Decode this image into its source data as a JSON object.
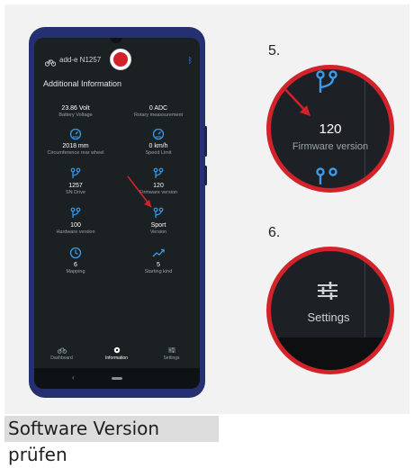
{
  "phone": {
    "device_name": "add-e N1257",
    "section_title": "Additional Information",
    "items": [
      {
        "value": "23.86 Volt",
        "label": "Battery Voltage",
        "icon": "none"
      },
      {
        "value": "0 ADC",
        "label": "Rotary meassurement",
        "icon": "none"
      },
      {
        "value": "2018 mm",
        "label": "Circumference rear wheel",
        "icon": "speedometer-icon"
      },
      {
        "value": "0 km/h",
        "label": "Speed Limit",
        "icon": "speedometer-icon"
      },
      {
        "value": "1257",
        "label": "SN Drive",
        "icon": "branch-icon"
      },
      {
        "value": "120",
        "label": "Firmware version",
        "icon": "branch-icon"
      },
      {
        "value": "100",
        "label": "Hardware version",
        "icon": "branch-icon"
      },
      {
        "value": "Sport",
        "label": "Version",
        "icon": "branch-icon"
      },
      {
        "value": "6",
        "label": "Mapping",
        "icon": "clock-icon"
      },
      {
        "value": "5",
        "label": "Starting kind",
        "icon": "trending-icon"
      }
    ],
    "nav": [
      {
        "label": "Dashboard",
        "icon": "bike-icon"
      },
      {
        "label": "Information",
        "icon": "info-gear-icon",
        "active": true
      },
      {
        "label": "Settings",
        "icon": "sliders-icon"
      }
    ]
  },
  "zoom": {
    "step5": {
      "number": "5.",
      "value": "120",
      "label": "Firmware version"
    },
    "step6": {
      "number": "6.",
      "label": "Settings"
    }
  },
  "caption": "Software Version prüfen",
  "colors": {
    "accent": "#2a90e6",
    "annotation": "#d2232a",
    "screen_bg": "#1b2023",
    "phone_frame": "#24306f"
  }
}
